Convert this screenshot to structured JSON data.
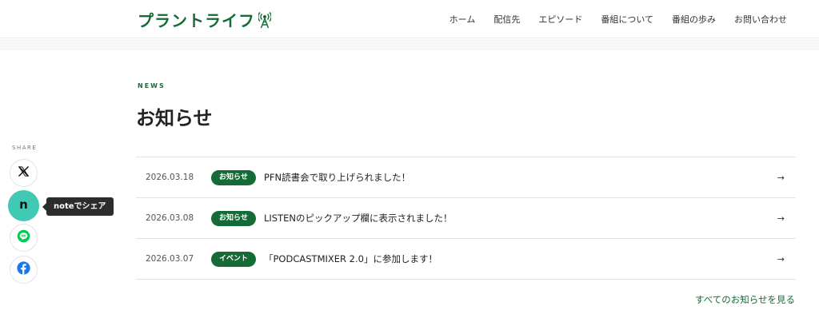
{
  "header": {
    "logo_text": "プラントライフ",
    "nav": [
      "ホーム",
      "配信先",
      "エピソード",
      "番組について",
      "番組の歩み",
      "お問い合わせ"
    ]
  },
  "section": {
    "kicker": "NEWS",
    "title": "お知らせ"
  },
  "news": [
    {
      "date": "2026.03.18",
      "tag": "お知らせ",
      "title": "PFN読書会で取り上げられました！",
      "arrow": "→"
    },
    {
      "date": "2026.03.08",
      "tag": "お知らせ",
      "title": "LISTENのピックアップ欄に表示されました！",
      "arrow": "→"
    },
    {
      "date": "2026.03.07",
      "tag": "イベント",
      "title": "「PODCASTMIXER 2.0」に参加します！",
      "arrow": "→"
    }
  ],
  "all_link": "すべてのお知らせを見る",
  "share": {
    "label": "SHARE",
    "note_glyph": "n",
    "tooltip": "noteでシェア",
    "icons": [
      "x-icon",
      "note-icon",
      "line-icon",
      "facebook-icon"
    ]
  },
  "colors": {
    "brand_green": "#146b35",
    "note_teal": "#41c9b4",
    "line_green": "#06c755",
    "facebook_blue": "#1877f2"
  }
}
